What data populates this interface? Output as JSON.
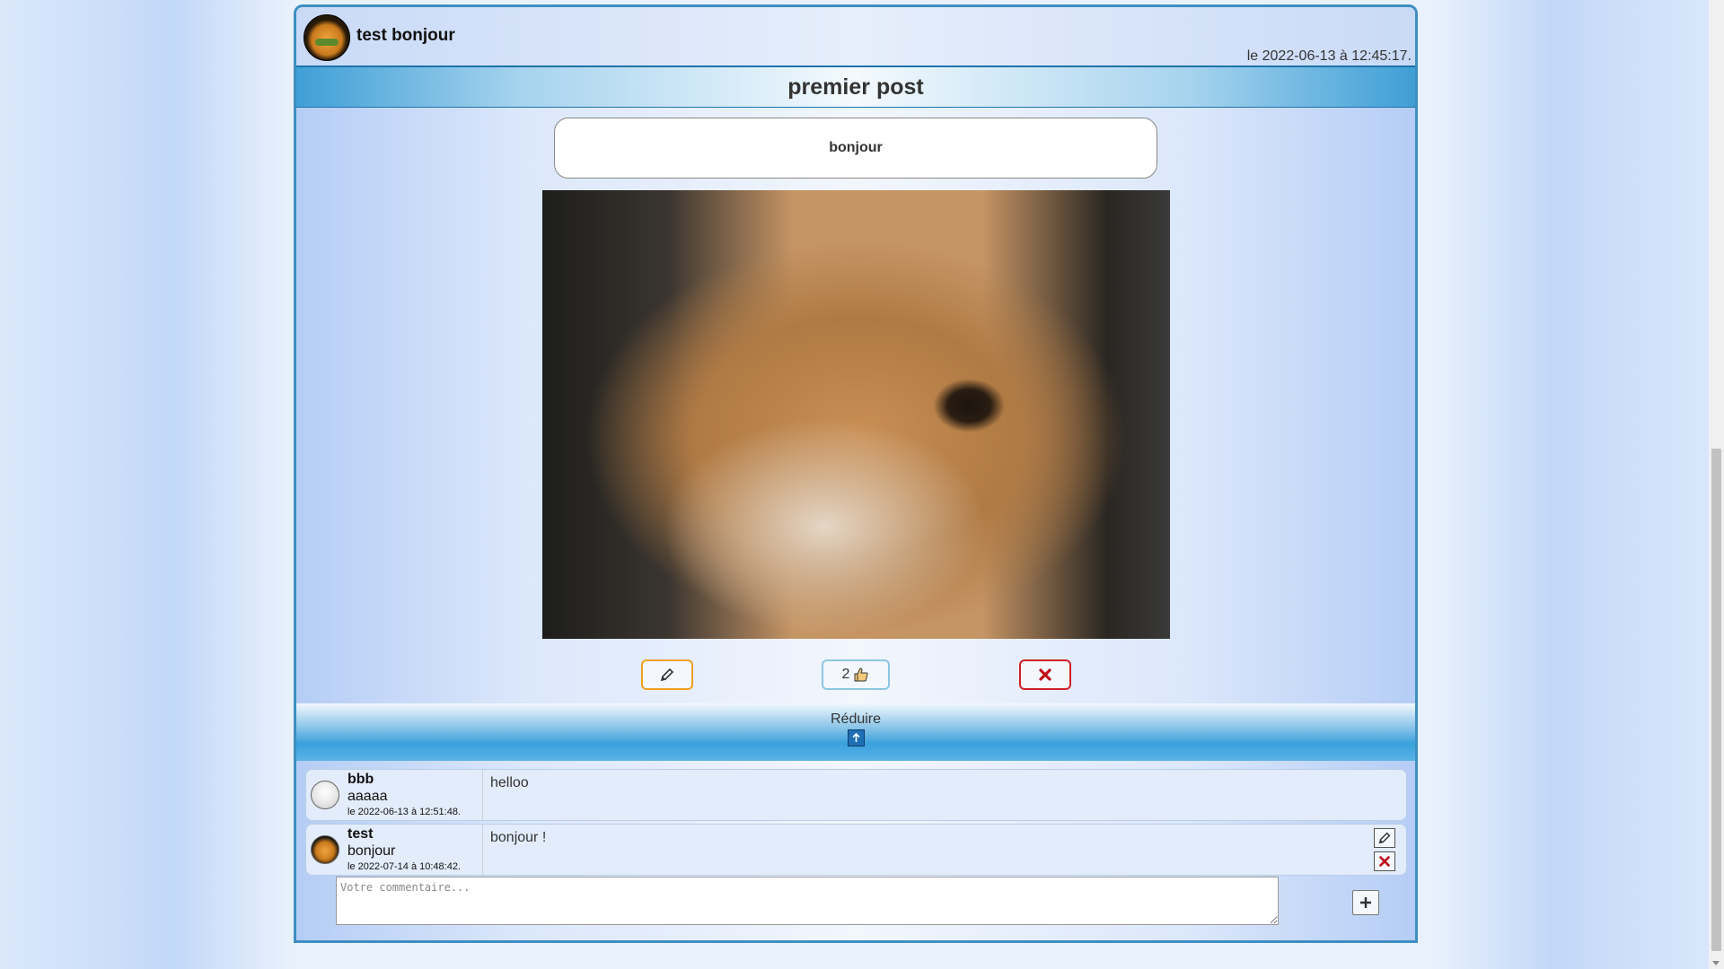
{
  "post": {
    "author": "test bonjour",
    "date": "le 2022-06-13 à 12:45:17.",
    "title": "premier post",
    "content": "bonjour",
    "image_alt": "shiba dog gif",
    "likes": "2",
    "reduce_label": "Réduire"
  },
  "comments": [
    {
      "user": "bbb",
      "name": "aaaaa",
      "date": "le 2022-06-13 à 12:51:48.",
      "text": "helloo",
      "avatar": "default-avatar-icon"
    },
    {
      "user": "test",
      "name": "bonjour",
      "date": "le 2022-07-14 à 10:48:42.",
      "text": "bonjour !",
      "avatar": "burger-avatar-icon"
    }
  ],
  "comment_form": {
    "placeholder": "Votre commentaire..."
  },
  "colors": {
    "edit": "#f0a020",
    "like": "#8dc6e0",
    "delete": "#d0202a",
    "accent": "#3d8fc0"
  }
}
